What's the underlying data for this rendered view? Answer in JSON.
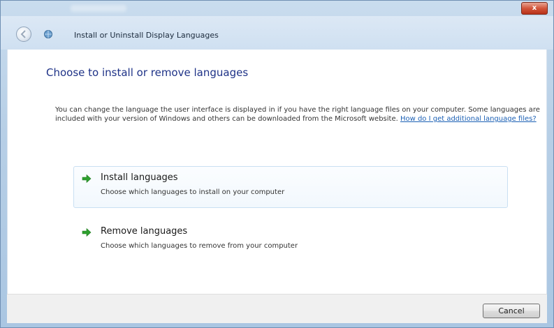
{
  "window": {
    "close_label": "x"
  },
  "navbar": {
    "title": "Install or Uninstall Display Languages"
  },
  "content": {
    "heading": "Choose to install or remove languages",
    "description": "You can change the language the user interface is displayed in if you have the right language files on your computer. Some languages are included with your version of Windows and others can be downloaded from the Microsoft website.",
    "help_link": "How do I get additional language files?"
  },
  "options": [
    {
      "title": "Install languages",
      "subtitle": "Choose which languages to install on your computer"
    },
    {
      "title": "Remove languages",
      "subtitle": "Choose which languages to remove from your computer"
    }
  ],
  "footer": {
    "cancel_label": "Cancel"
  },
  "colors": {
    "heading": "#1e3287",
    "link": "#1a5fb4",
    "arrow": "#2ea02e",
    "close_button": "#c8452a"
  }
}
